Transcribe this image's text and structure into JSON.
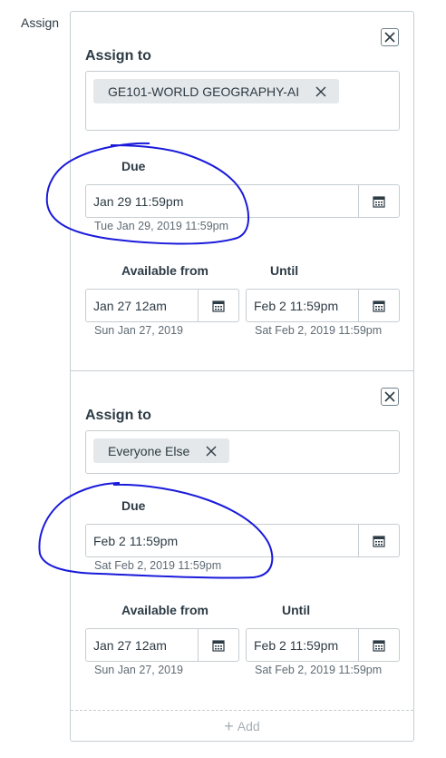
{
  "side_label": "Assign",
  "cards": [
    {
      "assign_to_label": "Assign to",
      "assignee": "GE101-WORLD GEOGRAPHY-AI",
      "due": {
        "label": "Due",
        "value": "Jan 29 11:59pm",
        "full": "Tue Jan 29, 2019 11:59pm"
      },
      "available_from": {
        "label": "Available from",
        "value": "Jan 27 12am",
        "full": "Sun Jan 27, 2019"
      },
      "until": {
        "label": "Until",
        "value": "Feb 2 11:59pm",
        "full": "Sat Feb 2, 2019 11:59pm"
      }
    },
    {
      "assign_to_label": "Assign to",
      "assignee": "Everyone Else",
      "due": {
        "label": "Due",
        "value": "Feb 2 11:59pm",
        "full": "Sat Feb 2, 2019 11:59pm"
      },
      "available_from": {
        "label": "Available from",
        "value": "Jan 27 12am",
        "full": "Sun Jan 27, 2019"
      },
      "until": {
        "label": "Until",
        "value": "Feb 2 11:59pm",
        "full": "Sat Feb 2, 2019 11:59pm"
      }
    }
  ],
  "add_label": "Add",
  "icons": {
    "close": "close-icon",
    "calendar": "calendar-icon",
    "remove": "remove-token-icon",
    "add": "plus-icon"
  },
  "colors": {
    "annotation": "#1a1adb",
    "border": "#c7cdd1",
    "token_bg": "#e5e8ea"
  }
}
